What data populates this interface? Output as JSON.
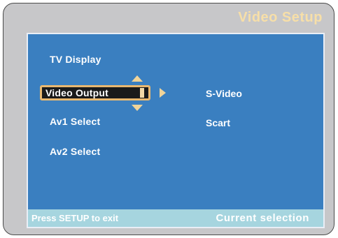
{
  "screen": {
    "title": "Video Setup"
  },
  "menu": {
    "items": [
      {
        "label": "TV Display",
        "selected": false
      },
      {
        "label": "Video Output",
        "selected": true
      },
      {
        "label": "Av1 Select",
        "selected": false
      },
      {
        "label": "Av2 Select",
        "selected": false
      }
    ]
  },
  "options": {
    "items": [
      {
        "label": "S-Video"
      },
      {
        "label": "Scart"
      }
    ]
  },
  "status": {
    "hint": "Press SETUP to exit",
    "current": "Current  selection"
  },
  "colors": {
    "frame": "#c7c7c9",
    "panel": "#3a7fc0",
    "title": "#f7dfa8",
    "highlight_border": "#e8b870",
    "statusbar": "#a6d5df"
  },
  "icons": {
    "up": "arrow-up-icon",
    "down": "arrow-down-icon",
    "right": "arrow-right-icon"
  }
}
